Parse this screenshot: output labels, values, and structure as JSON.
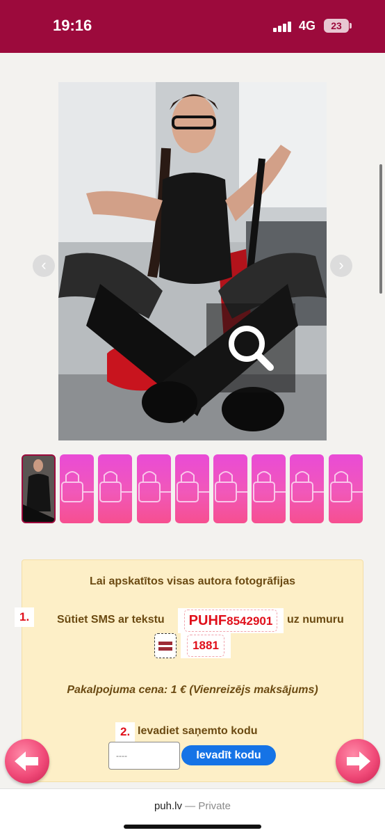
{
  "status_bar": {
    "time": "19:16",
    "network": "4G",
    "battery": "23"
  },
  "gallery": {
    "prev_arrow": "‹",
    "next_arrow": "›",
    "thumbnail_count": 9
  },
  "panel": {
    "title": "Lai apskatītos visas autora fotogrāfijas",
    "step1_number": "1.",
    "step1_text": "Sūtiet SMS ar tekstu",
    "sms_prefix": "PUHF",
    "sms_code": "8542901",
    "to_number_text": "uz numuru",
    "phone_number": "1881",
    "price": "Pakalpojuma cena: 1 € (Vienreizējs maksājums)",
    "step2_number": "2.",
    "step2_text": "Ievadiet saņemto kodu",
    "code_placeholder": "----",
    "submit_label": "Ievadīt kodu"
  },
  "browser": {
    "domain": "puh.lv",
    "mode": "— Private"
  },
  "colors": {
    "header": "#9c0a3c",
    "panel_bg": "#fdefc7",
    "accent_red": "#e0101b",
    "button_blue": "#1573e6"
  },
  "icons": [
    "signal-icon",
    "battery-icon",
    "zoom-icon",
    "lock-icon",
    "arrow-left-icon",
    "arrow-right-icon",
    "latvia-flag-icon"
  ]
}
